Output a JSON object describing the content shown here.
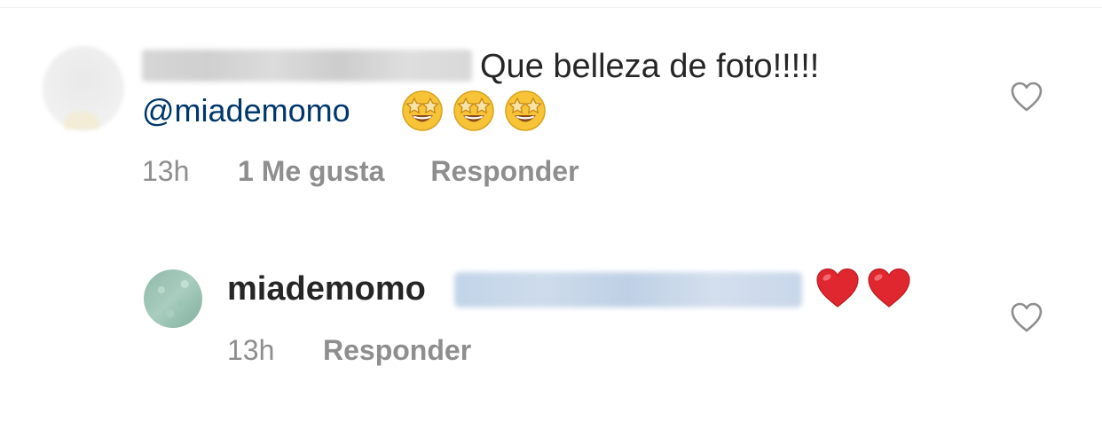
{
  "comments": [
    {
      "text": "Que belleza de foto!!!!!",
      "mention": "@miademomo",
      "emoji": [
        "star-struck-emoji",
        "star-struck-emoji",
        "star-struck-emoji"
      ],
      "time": "13h",
      "likes": "1 Me gusta",
      "reply": "Responder"
    },
    {
      "username": "miademomo",
      "emoji": [
        "red-heart-emoji",
        "red-heart-emoji"
      ],
      "time": "13h",
      "reply": "Responder"
    }
  ],
  "colors": {
    "mention": "#00376b",
    "meta": "#8e8e8e",
    "text": "#262626",
    "heart_emoji": "#e0262f"
  },
  "icons": {
    "like": "heart-outline-icon"
  }
}
